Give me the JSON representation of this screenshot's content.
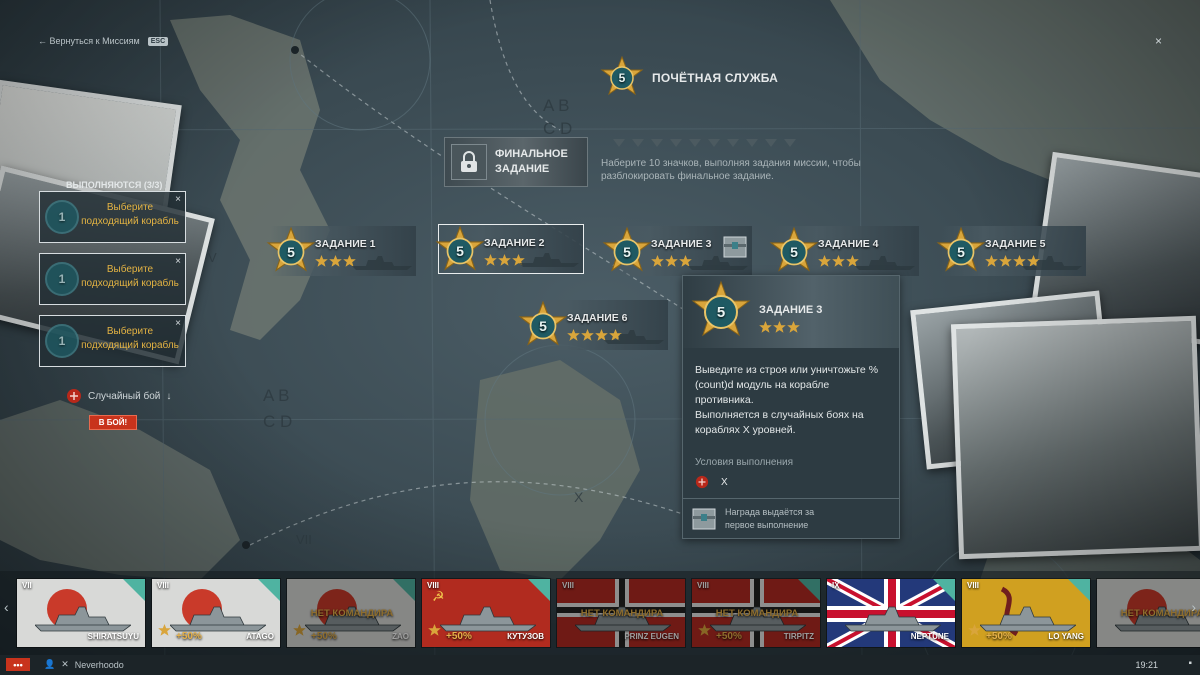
{
  "nav": {
    "back_label": "← Вернуться к Миссиям",
    "esc_badge": "ESC",
    "close_label": "×"
  },
  "campaign": {
    "badge_number": "5",
    "title": "ПОЧЁТНАЯ СЛУЖБА"
  },
  "final_task": {
    "label": "ФИНАЛЬНОЕ ЗАДАНИЕ",
    "description": "Наберите 10 значков, выполняя задания миссии, чтобы разблокировать финальное задание.",
    "slots_count": 10
  },
  "active_panel": {
    "heading": "ВЫПОЛНЯЮТСЯ (3/3)",
    "slots": [
      {
        "text": "Выберите подходящий корабль",
        "badge": "1"
      },
      {
        "text": "Выберите подходящий корабль",
        "badge": "1"
      },
      {
        "text": "Выберите подходящий корабль",
        "badge": "1"
      }
    ],
    "battle_mode": "Случайный бой",
    "battle_button": "В БОЙ!"
  },
  "tasks": [
    {
      "title": "ЗАДАНИЕ 1",
      "badge": "5",
      "stars": 3
    },
    {
      "title": "ЗАДАНИЕ 2",
      "badge": "5",
      "stars": 3
    },
    {
      "title": "ЗАДАНИЕ 3",
      "badge": "5",
      "stars": 3
    },
    {
      "title": "ЗАДАНИЕ 4",
      "badge": "5",
      "stars": 3
    },
    {
      "title": "ЗАДАНИЕ 5",
      "badge": "5",
      "stars": 4
    },
    {
      "title": "ЗАДАНИЕ 6",
      "badge": "5",
      "stars": 4
    }
  ],
  "tooltip": {
    "badge": "5",
    "title": "ЗАДАНИЕ 3",
    "stars": 3,
    "description_1": "Выведите из строя или уничтожьте %(count)d модуль на корабле противника.",
    "description_2": "Выполняется в случайных боях на кораблях X уровней.",
    "conditions_heading": "Условия выполнения",
    "condition_value": "X",
    "reward_text": "Награда выдаётся за первое выполнение"
  },
  "map_labels": [
    "A B",
    "C D",
    "A B",
    "C D",
    "V",
    "VII",
    "X"
  ],
  "ships": [
    {
      "tier": "VII",
      "name": "SHIRATSUYU",
      "flag": "japan",
      "no_commander": false,
      "bonus": "",
      "dim": false
    },
    {
      "tier": "VIII",
      "name": "ATAGO",
      "flag": "japan",
      "no_commander": false,
      "bonus": "+50%",
      "dim": false
    },
    {
      "tier": "",
      "name": "ZAO",
      "flag": "japan",
      "no_commander": true,
      "bonus": "+50%",
      "dim": true
    },
    {
      "tier": "VIII",
      "name": "КУТУЗОВ",
      "flag": "ussr",
      "no_commander": false,
      "bonus": "+50%",
      "dim": false
    },
    {
      "tier": "VIII",
      "name": "PRINZ EUGEN",
      "flag": "germany",
      "no_commander": true,
      "bonus": "",
      "dim": true
    },
    {
      "tier": "VIII",
      "name": "TIRPITZ",
      "flag": "germany",
      "no_commander": true,
      "bonus": "+50%",
      "dim": true
    },
    {
      "tier": "IX",
      "name": "NEPTUNE",
      "flag": "uk",
      "no_commander": false,
      "bonus": "",
      "dim": false
    },
    {
      "tier": "VIII",
      "name": "LO YANG",
      "flag": "china",
      "no_commander": false,
      "bonus": "+50%",
      "dim": false
    },
    {
      "tier": "",
      "name": "",
      "flag": "japan",
      "no_commander": true,
      "bonus": "",
      "dim": true
    }
  ],
  "no_commander_label": "НЕТ КОМАНДИРА",
  "bottom_bar": {
    "menu": "•••",
    "player": "Neverhoodo",
    "clock": "19:21"
  },
  "colors": {
    "accent_gold": "#e3b343",
    "battle_red": "#c8331c",
    "teal_corner": "#4fb3a1",
    "map_blue": "#3a4a52"
  }
}
